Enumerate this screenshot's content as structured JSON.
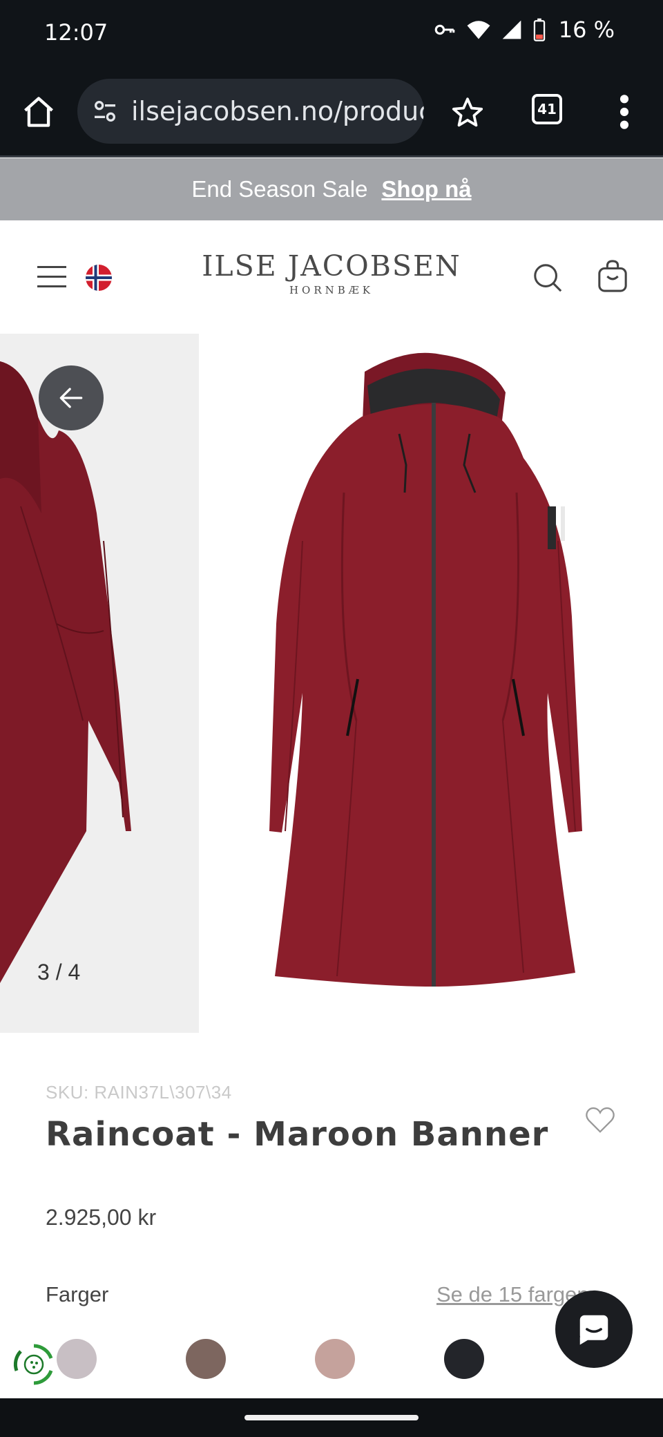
{
  "status_bar": {
    "time": "12:07",
    "battery_percent": "16 %",
    "icons": [
      "key-icon",
      "wifi-icon",
      "signal-icon",
      "battery-low-icon"
    ]
  },
  "browser": {
    "url": "ilsejacobsen.no/product",
    "tab_count": "41",
    "icons": [
      "home-icon",
      "site-settings-icon",
      "star-icon",
      "tabs-icon",
      "more-vert-icon"
    ]
  },
  "promo": {
    "text": "End Season Sale",
    "link": "Shop nå"
  },
  "header": {
    "brand_name": "ILSE JACOBSEN",
    "brand_sub": "HORNBÆK",
    "icons": [
      "menu-icon",
      "norway-flag-icon",
      "search-icon",
      "cart-icon"
    ]
  },
  "gallery": {
    "counter": "3 / 4",
    "product_color": "#8b1e2b",
    "icons": [
      "arrow-left-icon",
      "chevron-left-icon",
      "chevron-right-icon"
    ]
  },
  "product": {
    "sku": "SKU: RAIN37L\\307\\34",
    "title": "Raincoat - Maroon Banner",
    "price": "2.925,00 kr",
    "colors_label": "Farger",
    "colors_link": "Se de 15 fargene",
    "swatches": [
      "#c8bfc4",
      "#7d665f",
      "#c5a29c",
      "#23252a"
    ]
  },
  "widgets": {
    "icons": [
      "eco-badge-icon",
      "chat-icon"
    ]
  }
}
